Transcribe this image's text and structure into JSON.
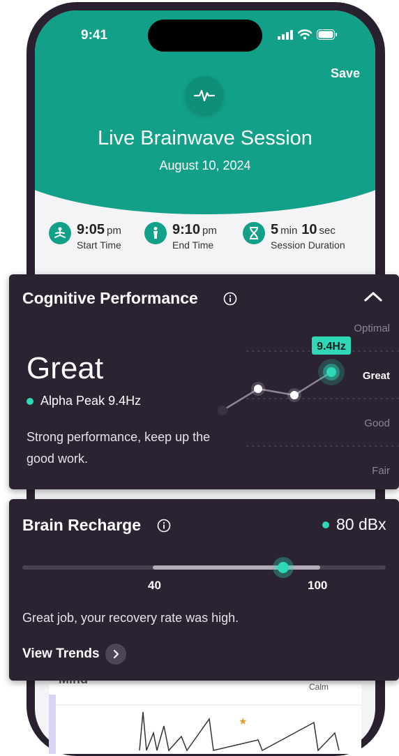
{
  "status_bar": {
    "time": "9:41"
  },
  "header": {
    "save_label": "Save",
    "title": "Live Brainwave Session",
    "date": "August 10, 2024",
    "icon": "pulse-icon"
  },
  "stats": [
    {
      "value": "9:05",
      "unit": "pm",
      "label": "Start Time",
      "icon": "meditation-icon"
    },
    {
      "value": "9:10",
      "unit": "pm",
      "label": "End Time",
      "icon": "person-standing-icon"
    },
    {
      "value_min": "5",
      "unit_min": "min",
      "value_sec": "10",
      "unit_sec": "sec",
      "label": "Session Duration",
      "icon": "hourglass-icon"
    }
  ],
  "cognitive": {
    "title": "Cognitive Performance",
    "rating": "Great",
    "peak_label": "Alpha Peak 9.4Hz",
    "description": "Strong performance, keep up the good work.",
    "current_value_label": "9.4Hz",
    "levels": [
      "Optimal",
      "Great",
      "Good",
      "Fair"
    ],
    "active_level": "Great",
    "accent": "#2fd8b6"
  },
  "recharge": {
    "title": "Brain Recharge",
    "value": "80 dBx",
    "range_min_label": "40",
    "range_max_label": "100",
    "level": 0.8,
    "description": "Great job, your recovery rate was high.",
    "view_trends_label": "View Trends"
  },
  "background_peek": {
    "section": "Mind",
    "calm_label": "Calm"
  },
  "colors": {
    "teal": "#13a088",
    "card": "#2b2232",
    "accent": "#2fd8b6"
  }
}
